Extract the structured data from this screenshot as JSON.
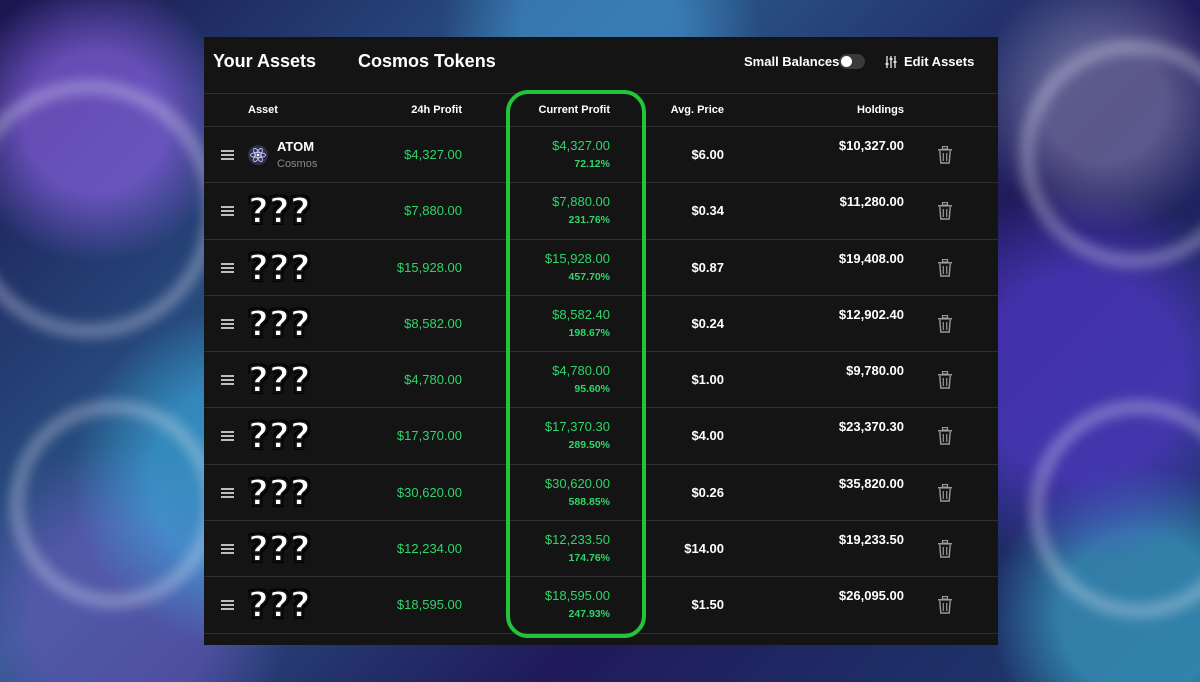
{
  "header": {
    "your_assets": "Your Assets",
    "cosmos_tokens": "Cosmos Tokens",
    "small_balances": "Small Balances",
    "small_balances_toggle": "off",
    "edit_assets": "Edit Assets"
  },
  "columns": {
    "asset": "Asset",
    "profit_24h": "24h Profit",
    "current_profit": "Current Profit",
    "avg_price": "Avg. Price",
    "holdings": "Holdings"
  },
  "colors": {
    "profit_green": "#2fd56a",
    "highlight_green": "#22c43a",
    "panel_bg": "#141414"
  },
  "rows": [
    {
      "name": "ATOM",
      "sub": "Cosmos",
      "mystery": "",
      "profit_24h": "$4,327.00",
      "current_profit": "$4,327.00",
      "current_pct": "72.12%",
      "avg_price": "$6.00",
      "holdings": "$10,327.00"
    },
    {
      "name": "",
      "sub": "",
      "mystery": "???",
      "profit_24h": "$7,880.00",
      "current_profit": "$7,880.00",
      "current_pct": "231.76%",
      "avg_price": "$0.34",
      "holdings": "$11,280.00"
    },
    {
      "name": "",
      "sub": "",
      "mystery": "???",
      "profit_24h": "$15,928.00",
      "current_profit": "$15,928.00",
      "current_pct": "457.70%",
      "avg_price": "$0.87",
      "holdings": "$19,408.00"
    },
    {
      "name": "",
      "sub": "",
      "mystery": "???",
      "profit_24h": "$8,582.00",
      "current_profit": "$8,582.40",
      "current_pct": "198.67%",
      "avg_price": "$0.24",
      "holdings": "$12,902.40"
    },
    {
      "name": "",
      "sub": "",
      "mystery": "???",
      "profit_24h": "$4,780.00",
      "current_profit": "$4,780.00",
      "current_pct": "95.60%",
      "avg_price": "$1.00",
      "holdings": "$9,780.00"
    },
    {
      "name": "",
      "sub": "",
      "mystery": "???",
      "profit_24h": "$17,370.00",
      "current_profit": "$17,370.30",
      "current_pct": "289.50%",
      "avg_price": "$4.00",
      "holdings": "$23,370.30"
    },
    {
      "name": "",
      "sub": "",
      "mystery": "???",
      "profit_24h": "$30,620.00",
      "current_profit": "$30,620.00",
      "current_pct": "588.85%",
      "avg_price": "$0.26",
      "holdings": "$35,820.00"
    },
    {
      "name": "",
      "sub": "",
      "mystery": "???",
      "profit_24h": "$12,234.00",
      "current_profit": "$12,233.50",
      "current_pct": "174.76%",
      "avg_price": "$14.00",
      "holdings": "$19,233.50"
    },
    {
      "name": "",
      "sub": "",
      "mystery": "???",
      "profit_24h": "$18,595.00",
      "current_profit": "$18,595.00",
      "current_pct": "247.93%",
      "avg_price": "$1.50",
      "holdings": "$26,095.00"
    }
  ]
}
